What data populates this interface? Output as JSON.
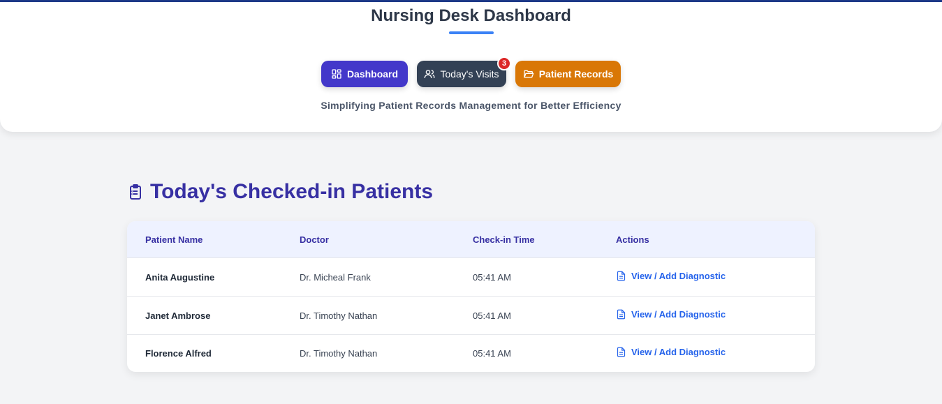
{
  "header": {
    "title": "Nursing Desk Dashboard",
    "subtitle": "Simplifying Patient Records Management for Better Efficiency",
    "nav": {
      "dashboard_label": "Dashboard",
      "visits_label": "Today's Visits",
      "visits_badge": "3",
      "records_label": "Patient Records"
    }
  },
  "section": {
    "title": "Today's Checked-in Patients"
  },
  "table": {
    "columns": [
      "Patient Name",
      "Doctor",
      "Check-in Time",
      "Actions"
    ],
    "rows": [
      {
        "patient": "Anita Augustine",
        "doctor": "Dr. Micheal Frank",
        "time": "05:41 AM",
        "action": "View / Add Diagnostic"
      },
      {
        "patient": "Janet Ambrose",
        "doctor": "Dr. Timothy Nathan",
        "time": "05:41 AM",
        "action": "View / Add Diagnostic"
      },
      {
        "patient": "Florence Alfred",
        "doctor": "Dr. Timothy Nathan",
        "time": "05:41 AM",
        "action": "View / Add Diagnostic"
      }
    ]
  },
  "colors": {
    "primary": "#4338ca",
    "visits": "#334155",
    "records": "#d97706",
    "badge": "#dc2626",
    "link": "#2563eb",
    "heading": "#3730a3"
  },
  "icons": {
    "dashboard": "grid-icon",
    "visits": "users-icon",
    "records": "folder-open-icon",
    "section": "clipboard-list-icon",
    "action": "file-text-icon"
  }
}
